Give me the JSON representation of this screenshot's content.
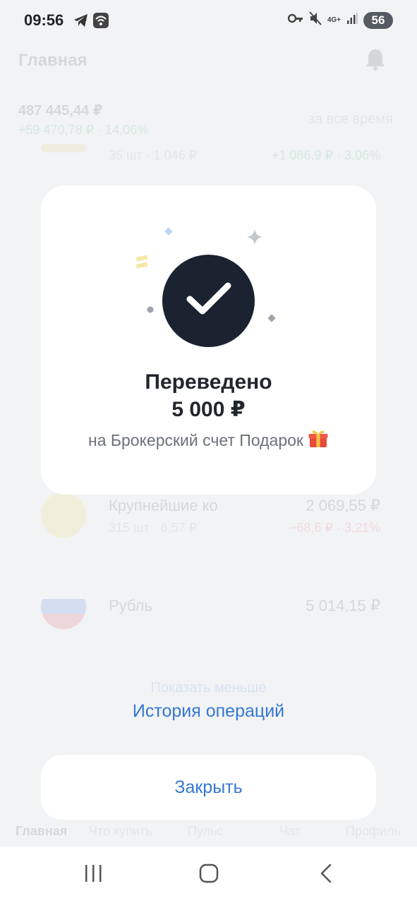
{
  "status_bar": {
    "time": "09:56",
    "network_label": "4G+",
    "battery": "56",
    "icons": [
      "telegram-icon",
      "wifi-icon",
      "key-icon",
      "mute-icon",
      "signal-icon"
    ]
  },
  "background": {
    "header_title": "Главная",
    "portfolio_total": "487 445,44 ₽",
    "portfolio_gain": "+59 470,78 ₽ · 14,06%",
    "period": "за все время",
    "rows": [
      {
        "name": "",
        "sub": "35 шт · 1 046 ₽",
        "value": "",
        "change": "+1 086,9 ₽ · 3,06%"
      },
      {
        "name": "Крупнейшие ко",
        "sub": "315 шт · 6,57 ₽",
        "value": "2 069,55 ₽",
        "change": "−68,6 ₽ · 3,21%"
      },
      {
        "name": "Рубль",
        "sub": "",
        "value": "5 014,15 ₽",
        "change": ""
      }
    ],
    "show_less": "Показать меньше",
    "tabs": [
      "Главная",
      "Что купить",
      "Пульс",
      "Чат",
      "Профиль"
    ]
  },
  "dialog": {
    "title": "Переведено",
    "amount": "5 000 ₽",
    "subtitle": "на Брокерский счет Подарок",
    "icon": "checkmark-icon",
    "emoji": "gift-icon"
  },
  "history_link": "История операций",
  "close_label": "Закрыть",
  "nav": [
    "recent-apps",
    "home",
    "back"
  ],
  "colors": {
    "accent": "#3478d1",
    "success_circle": "#1b2230",
    "background": "#f2f3f5",
    "gain": "#1aa35a",
    "loss": "#e0444f"
  }
}
